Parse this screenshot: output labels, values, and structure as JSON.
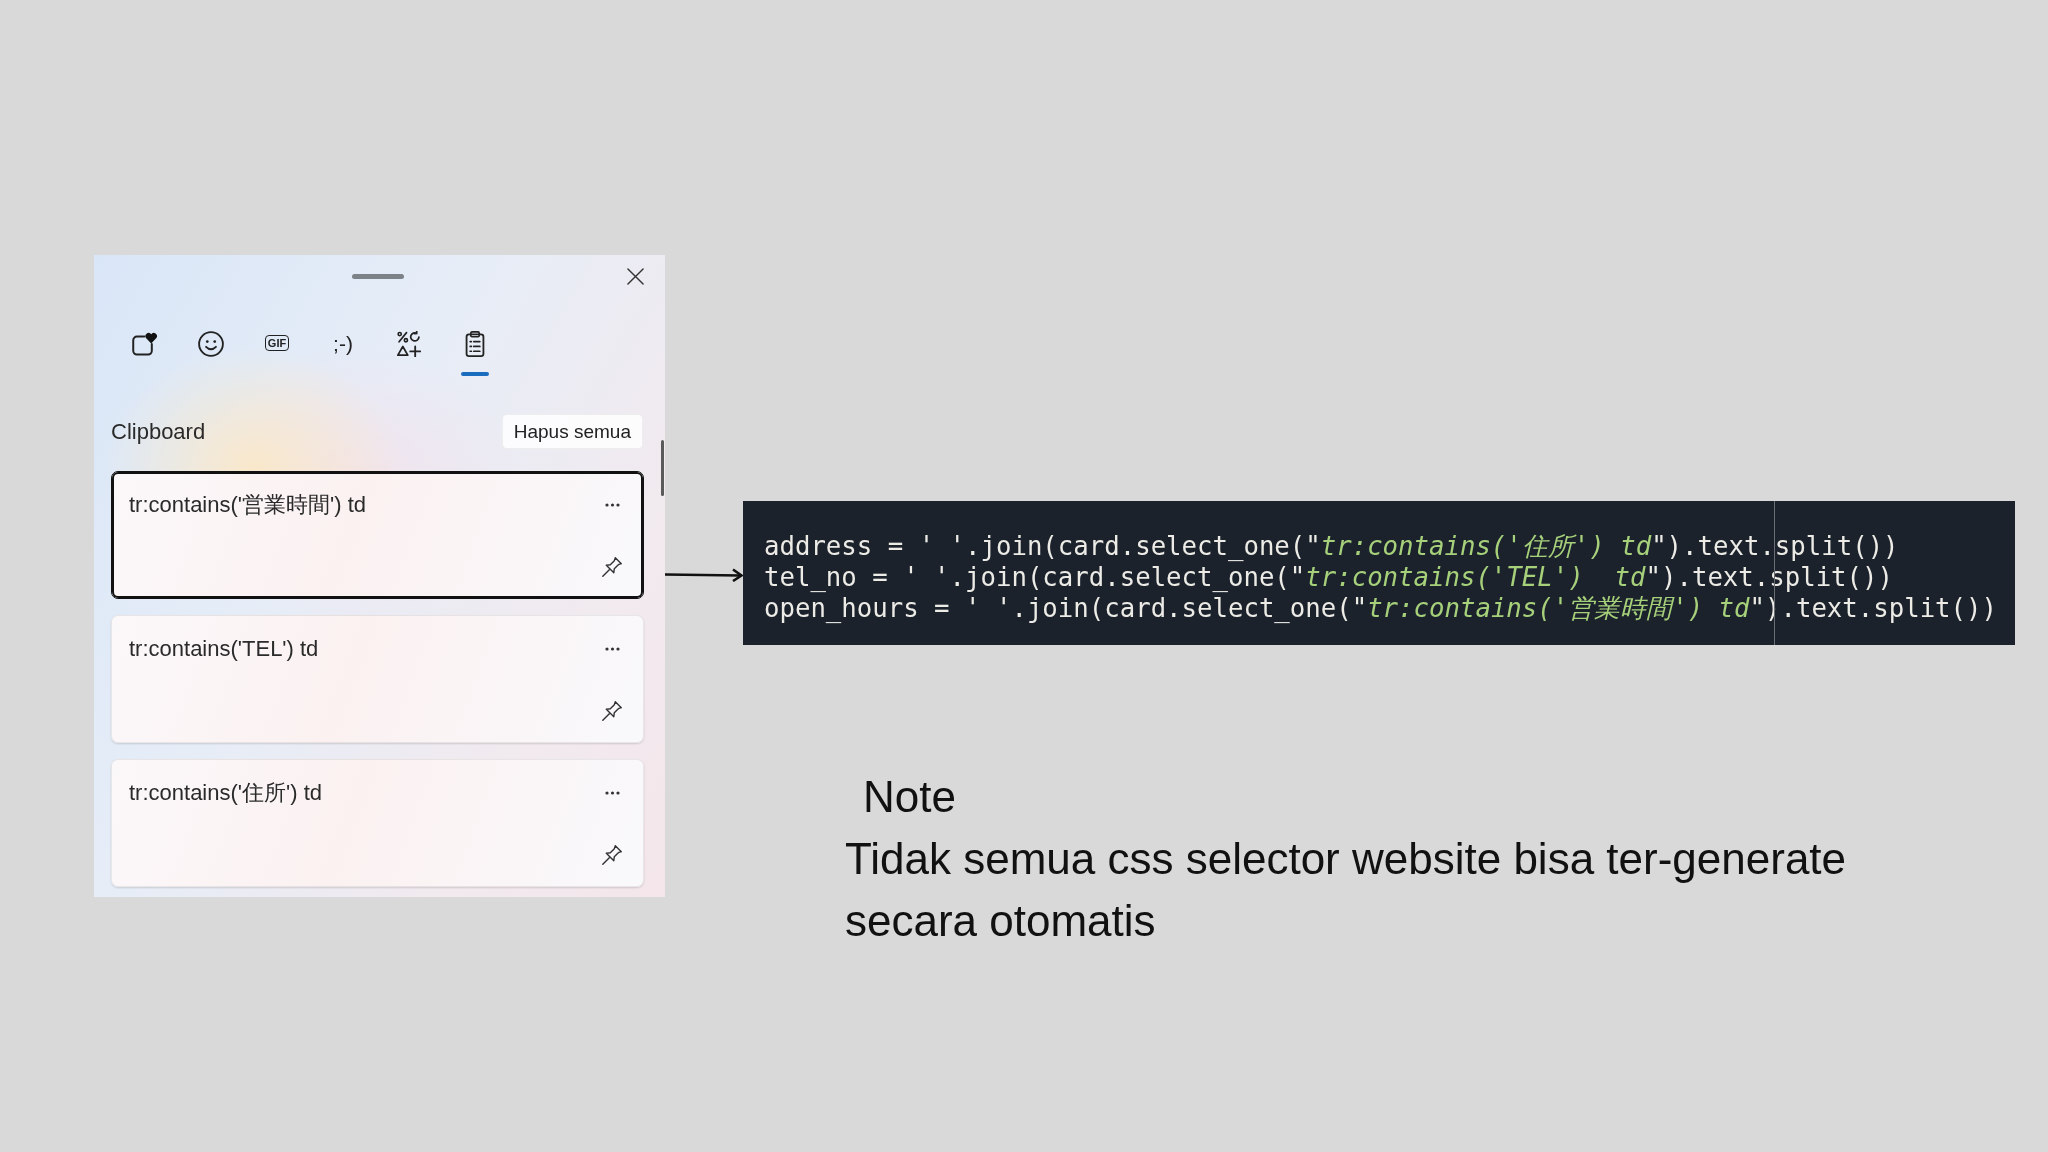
{
  "panel": {
    "tabs": [
      {
        "kind": "favorites",
        "selected": false
      },
      {
        "kind": "emoji",
        "selected": false
      },
      {
        "kind": "gif",
        "label": "GIF",
        "selected": false
      },
      {
        "kind": "kaomoji",
        "label": ";-)",
        "selected": false
      },
      {
        "kind": "symbols",
        "selected": false
      },
      {
        "kind": "clipboard",
        "selected": true
      }
    ],
    "heading": "Clipboard",
    "clear_button": "Hapus semua",
    "items": [
      {
        "text": "tr:contains('営業時間') td",
        "selected": true
      },
      {
        "text": "tr:contains('TEL') td",
        "selected": false
      },
      {
        "text": "tr:contains('住所') td",
        "selected": false
      }
    ]
  },
  "code_block": {
    "lines": [
      [
        {
          "kind": "plain",
          "text": "address = ' '.join(card.select_one(\""
        },
        {
          "kind": "string",
          "text": "tr:contains('住所') td"
        },
        {
          "kind": "plain",
          "text": "\").text.split())"
        }
      ],
      [
        {
          "kind": "plain",
          "text": "tel_no = ' '.join(card.select_one(\""
        },
        {
          "kind": "string",
          "text": "tr:contains('TEL')  td"
        },
        {
          "kind": "plain",
          "text": "\").text.split())"
        }
      ],
      [
        {
          "kind": "plain",
          "text": "open_hours = ' '.join(card.select_one(\""
        },
        {
          "kind": "string",
          "text": "tr:contains('営業時間') td"
        },
        {
          "kind": "plain",
          "text": "\").text.split())"
        }
      ]
    ]
  },
  "note": {
    "title": "Note",
    "text": "Tidak semua css selector website bisa ter-generate secara otomatis"
  }
}
